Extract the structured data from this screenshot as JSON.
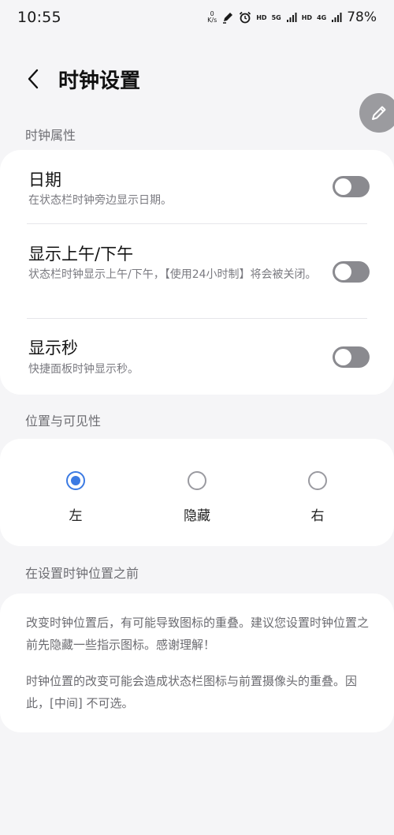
{
  "status_bar": {
    "time": "10:55",
    "net_speed_value": "0",
    "net_speed_unit": "K/s",
    "hd1": "HD",
    "net1": "5G",
    "hd2": "HD",
    "net2": "4G",
    "battery": "78%"
  },
  "header": {
    "title": "时钟设置"
  },
  "sections": {
    "clock_properties": {
      "title": "时钟属性",
      "items": [
        {
          "title": "日期",
          "description": "在状态栏时钟旁边显示日期。",
          "enabled": false
        },
        {
          "title": "显示上午/下午",
          "description": "状态栏时钟显示上午/下午，【使用24小时制】将会被关闭。",
          "enabled": false
        },
        {
          "title": "显示秒",
          "description": "快捷面板时钟显示秒。",
          "enabled": false
        }
      ]
    },
    "position": {
      "title": "位置与可见性",
      "options": [
        {
          "label": "左",
          "selected": true
        },
        {
          "label": "隐藏",
          "selected": false
        },
        {
          "label": "右",
          "selected": false
        }
      ]
    },
    "before_setting": {
      "title": "在设置时钟位置之前",
      "paragraph1": "改变时钟位置后，有可能导致图标的重叠。建议您设置时钟位置之前先隐藏一些指示图标。感谢理解！",
      "paragraph2": "时钟位置的改变可能会造成状态栏图标与前置摄像头的重叠。因此，[中间] 不可选。"
    }
  },
  "colors": {
    "background": "#f5f5f7",
    "card": "#ffffff",
    "accent": "#3b7ae3",
    "toggle_off": "#8a8a8f",
    "fab": "#9b9b9f"
  },
  "icons": {
    "back": "chevron-left-icon",
    "edit": "pencil-icon",
    "alarm": "alarm-icon",
    "pen_status": "pen-icon",
    "signal": "signal-icon"
  }
}
